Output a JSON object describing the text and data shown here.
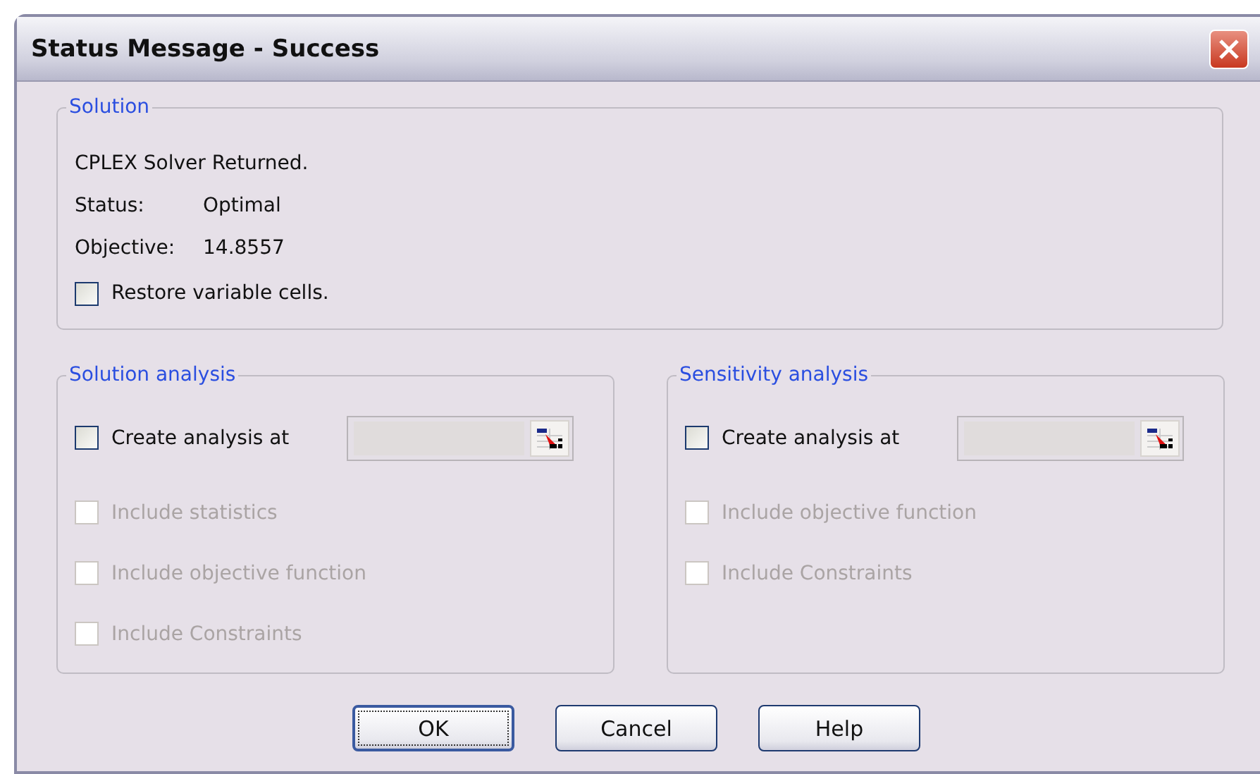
{
  "window": {
    "title": "Status Message - Success"
  },
  "solution": {
    "legend": "Solution",
    "message": "CPLEX Solver Returned.",
    "status_label": "Status:",
    "status_value": "Optimal",
    "objective_label": "Objective:",
    "objective_value": "14.8557",
    "restore": {
      "label": "Restore variable cells.",
      "checked": false,
      "disabled": false
    }
  },
  "groups": [
    {
      "legend": "Solution analysis",
      "create": {
        "label": "Create analysis at",
        "checked": false,
        "disabled": false
      },
      "field": {
        "disabled": true
      },
      "options": [
        {
          "label": "Include statistics",
          "checked": false,
          "disabled": true
        },
        {
          "label": "Include objective function",
          "checked": false,
          "disabled": true
        },
        {
          "label": "Include Constraints",
          "checked": false,
          "disabled": true
        }
      ]
    },
    {
      "legend": "Sensitivity analysis",
      "create": {
        "label": "Create analysis at",
        "checked": false,
        "disabled": false
      },
      "field": {
        "disabled": true
      },
      "options": [
        {
          "label": "Include objective function",
          "checked": false,
          "disabled": true
        },
        {
          "label": "Include Constraints",
          "checked": false,
          "disabled": true
        }
      ]
    }
  ],
  "buttons": [
    {
      "label": "OK",
      "focused": true
    },
    {
      "label": "Cancel",
      "focused": false
    },
    {
      "label": "Help",
      "focused": false
    }
  ]
}
